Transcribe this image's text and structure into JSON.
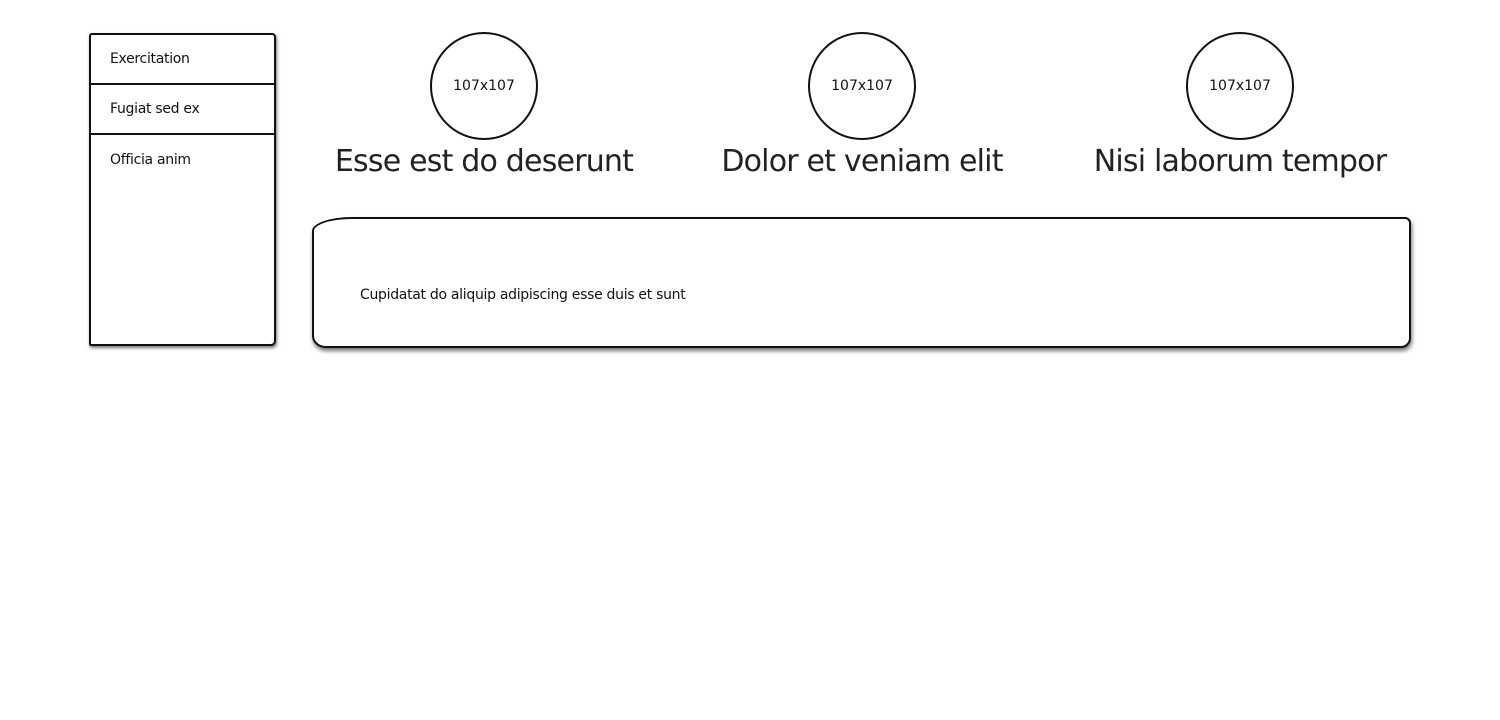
{
  "sidebar": {
    "items": [
      {
        "label": "Exercitation"
      },
      {
        "label": "Fugiat sed ex"
      },
      {
        "label": "Officia anim"
      }
    ]
  },
  "features": [
    {
      "image_label": "107x107",
      "heading": "Esse est do deserunt"
    },
    {
      "image_label": "107x107",
      "heading": "Dolor et veniam elit"
    },
    {
      "image_label": "107x107",
      "heading": "Nisi laborum tempor"
    }
  ],
  "panel": {
    "text": "Cupidatat do aliquip adipiscing esse duis et sunt"
  }
}
